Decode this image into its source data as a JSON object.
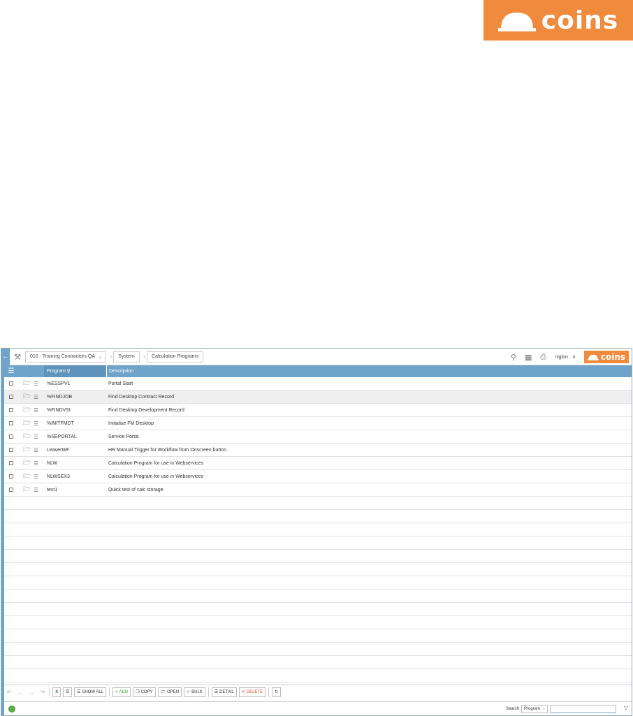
{
  "logo": {
    "text": "coins"
  },
  "topbar": {
    "company": "010 - Training Contractors QA",
    "crumbs": [
      "System",
      "Calculation Programs"
    ],
    "user": "niglon"
  },
  "grid": {
    "columns": [
      "Program",
      "Description"
    ],
    "rows": [
      {
        "program": "%ESSPV1",
        "description": "Portal Start"
      },
      {
        "program": "%FINDJOB",
        "description": "Find Desktop Contract Record"
      },
      {
        "program": "%FINDVSI",
        "description": "Find Desktop Development Record"
      },
      {
        "program": "%INITFMDT",
        "description": "Initialise FM Desktop"
      },
      {
        "program": "%SEPORTAL",
        "description": "Service Portal"
      },
      {
        "program": "LeaverWF",
        "description": "HR Manual Trigger for Workflow from Onscreen button."
      },
      {
        "program": "NLW",
        "description": "Calculation Program for use in Webservices"
      },
      {
        "program": "NLWSEX3",
        "description": "Calculation Program for use in Webservices"
      },
      {
        "program": "test1",
        "description": "Quick test of calc storage"
      }
    ]
  },
  "toolbar": {
    "show_all": "SHOW ALL",
    "add": "ADD",
    "copy": "COPY",
    "open": "OPEN",
    "bulk": "BULK",
    "detail": "DETAIL",
    "delete": "DELETE"
  },
  "status": {
    "search_label": "Search",
    "search_field": "Program"
  }
}
